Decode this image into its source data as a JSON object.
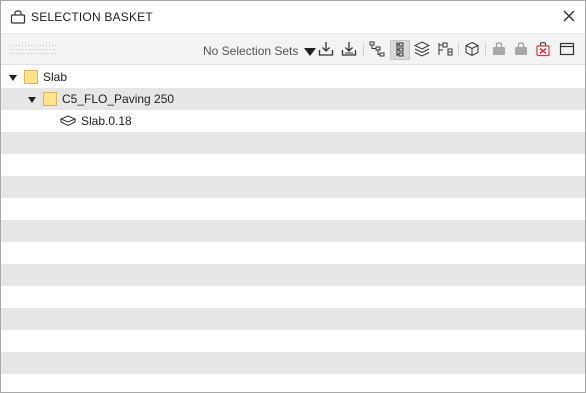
{
  "window": {
    "title": "SELECTION BASKET",
    "title_icon": "basket-icon",
    "close_icon": "close-icon"
  },
  "toolbar": {
    "grip_icon": "grip-handle-icon",
    "selection_sets": {
      "selected": "No Selection Sets",
      "icon": "dropdown-caret-icon"
    },
    "buttons": [
      {
        "name": "import-download-icon",
        "active": false
      },
      {
        "name": "export-download-icon",
        "active": false
      },
      {
        "name": "tree-hierarchy-icon",
        "active": false
      },
      {
        "name": "tree-list-icon",
        "active": true
      },
      {
        "name": "layers-stack-icon",
        "active": false
      },
      {
        "name": "group-structure-icon",
        "active": false
      },
      {
        "name": "cube-3d-icon",
        "active": false
      },
      {
        "name": "basket-add-icon",
        "active": false
      },
      {
        "name": "basket-remove-icon",
        "active": false
      },
      {
        "name": "basket-clear-icon",
        "active": false
      },
      {
        "name": "window-panel-icon",
        "active": false
      }
    ]
  },
  "tree": {
    "nodes": [
      {
        "label": "Slab",
        "level": 0,
        "expanded": true,
        "icon": "folder-icon"
      },
      {
        "label": "C5_FLO_Paving 250",
        "level": 1,
        "expanded": true,
        "icon": "folder-icon"
      },
      {
        "label": "Slab.0.18",
        "level": 2,
        "icon": "layer-element-icon"
      }
    ],
    "colors": {
      "row_alt": "#e6e6e6",
      "folder": "#ffe38a",
      "folder_border": "#d8b75a",
      "clear_icon": "#d23b3b"
    }
  }
}
